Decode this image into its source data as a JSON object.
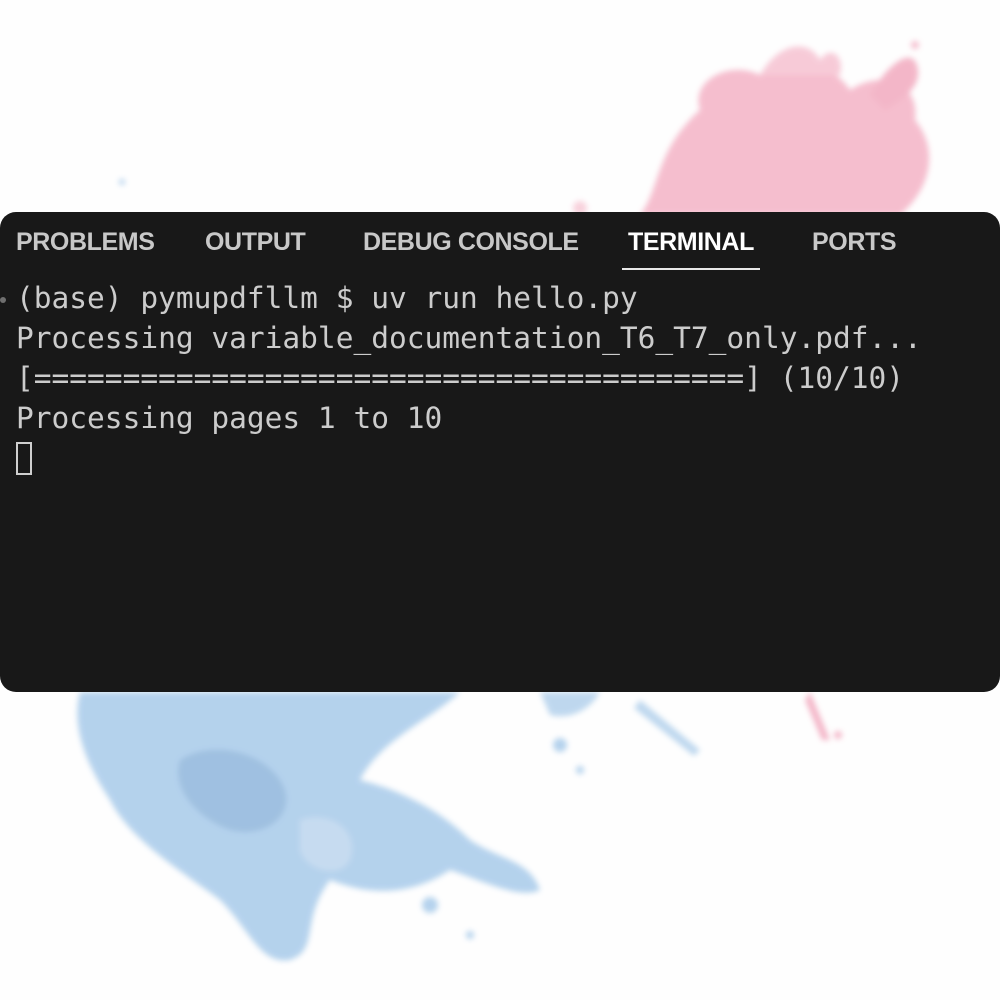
{
  "panel": {
    "tabs": [
      {
        "label": "PROBLEMS",
        "active": false
      },
      {
        "label": "OUTPUT",
        "active": false
      },
      {
        "label": "DEBUG CONSOLE",
        "active": false
      },
      {
        "label": "TERMINAL",
        "active": true
      },
      {
        "label": "PORTS",
        "active": false
      }
    ],
    "colors": {
      "background": "#181818",
      "text": "#cccccc",
      "active_tab": "#ffffff"
    }
  },
  "terminal": {
    "lines": [
      "(base) pymupdfllm $ uv run hello.py",
      "Processing variable_documentation_T6_T7_only.pdf...",
      "[========================================] (10/10)",
      "Processing pages 1 to 10"
    ],
    "cursor": "block-cursor"
  },
  "background": {
    "splash_colors": [
      "#f5b8c8",
      "#a9cbe8"
    ]
  }
}
